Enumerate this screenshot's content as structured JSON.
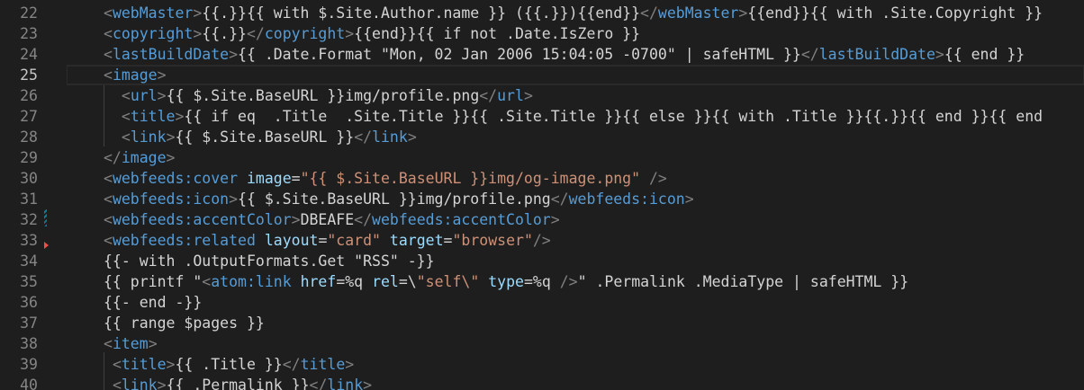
{
  "theme": {
    "background": "#1e1e1e",
    "line_number": "#858585",
    "line_number_active": "#c6c6c6",
    "tag_bracket": "#808080",
    "tag_name": "#569cd6",
    "attribute": "#9cdcfe",
    "string": "#ce9178",
    "text": "#d4d4d4",
    "gutter_modified": "#0c7d9d",
    "gutter_deleted": "#f14c4c"
  },
  "editor": {
    "active_line": 25,
    "lines": [
      {
        "num": "22",
        "tokens": [
          {
            "k": "tb",
            "t": "<"
          },
          {
            "k": "tn",
            "t": "webMaster"
          },
          {
            "k": "tb",
            "t": ">"
          },
          {
            "k": "tx",
            "t": "{{.}}{{ with $.Site.Author.name }} ({{.}}){{end}}"
          },
          {
            "k": "tb",
            "t": "</"
          },
          {
            "k": "tn",
            "t": "webMaster"
          },
          {
            "k": "tb",
            "t": ">"
          },
          {
            "k": "tx",
            "t": "{{end}}{{ with .Site.Copyright }}"
          }
        ]
      },
      {
        "num": "23",
        "tokens": [
          {
            "k": "tb",
            "t": "<"
          },
          {
            "k": "tn",
            "t": "copyright"
          },
          {
            "k": "tb",
            "t": ">"
          },
          {
            "k": "tx",
            "t": "{{.}}"
          },
          {
            "k": "tb",
            "t": "</"
          },
          {
            "k": "tn",
            "t": "copyright"
          },
          {
            "k": "tb",
            "t": ">"
          },
          {
            "k": "tx",
            "t": "{{end}}{{ if not .Date.IsZero }}"
          }
        ]
      },
      {
        "num": "24",
        "tokens": [
          {
            "k": "tb",
            "t": "<"
          },
          {
            "k": "tn",
            "t": "lastBuildDate"
          },
          {
            "k": "tb",
            "t": ">"
          },
          {
            "k": "tx",
            "t": "{{ .Date.Format \"Mon, 02 Jan 2006 15:04:05 -0700\" | safeHTML }}"
          },
          {
            "k": "tb",
            "t": "</"
          },
          {
            "k": "tn",
            "t": "lastBuildDate"
          },
          {
            "k": "tb",
            "t": ">"
          },
          {
            "k": "tx",
            "t": "{{ end }}"
          }
        ]
      },
      {
        "num": "25",
        "tokens": [
          {
            "k": "tb",
            "t": "<"
          },
          {
            "k": "tn",
            "t": "image"
          },
          {
            "k": "tb",
            "t": ">"
          }
        ]
      },
      {
        "num": "26",
        "tokens": [
          {
            "k": "tx",
            "t": "  "
          },
          {
            "k": "tb",
            "t": "<"
          },
          {
            "k": "tn",
            "t": "url"
          },
          {
            "k": "tb",
            "t": ">"
          },
          {
            "k": "tx",
            "t": "{{ $.Site.BaseURL }}img/profile.png"
          },
          {
            "k": "tb",
            "t": "</"
          },
          {
            "k": "tn",
            "t": "url"
          },
          {
            "k": "tb",
            "t": ">"
          }
        ]
      },
      {
        "num": "27",
        "tokens": [
          {
            "k": "tx",
            "t": "  "
          },
          {
            "k": "tb",
            "t": "<"
          },
          {
            "k": "tn",
            "t": "title"
          },
          {
            "k": "tb",
            "t": ">"
          },
          {
            "k": "tx",
            "t": "{{ if eq  .Title  .Site.Title }}{{ .Site.Title }}{{ else }}{{ with .Title }}{{.}}{{ end }}{{ end"
          }
        ]
      },
      {
        "num": "28",
        "tokens": [
          {
            "k": "tx",
            "t": "  "
          },
          {
            "k": "tb",
            "t": "<"
          },
          {
            "k": "tn",
            "t": "link"
          },
          {
            "k": "tb",
            "t": ">"
          },
          {
            "k": "tx",
            "t": "{{ $.Site.BaseURL }}"
          },
          {
            "k": "tb",
            "t": "</"
          },
          {
            "k": "tn",
            "t": "link"
          },
          {
            "k": "tb",
            "t": ">"
          }
        ]
      },
      {
        "num": "29",
        "tokens": [
          {
            "k": "tb",
            "t": "</"
          },
          {
            "k": "tn",
            "t": "image"
          },
          {
            "k": "tb",
            "t": ">"
          }
        ]
      },
      {
        "num": "30",
        "tokens": [
          {
            "k": "tb",
            "t": "<"
          },
          {
            "k": "tn",
            "t": "webfeeds:cover"
          },
          {
            "k": "tx",
            "t": " "
          },
          {
            "k": "at",
            "t": "image"
          },
          {
            "k": "tx",
            "t": "="
          },
          {
            "k": "st",
            "t": "\"{{ $.Site.BaseURL }}img/og-image.png\""
          },
          {
            "k": "tx",
            "t": " "
          },
          {
            "k": "tb",
            "t": "/>"
          }
        ]
      },
      {
        "num": "31",
        "tokens": [
          {
            "k": "tb",
            "t": "<"
          },
          {
            "k": "tn",
            "t": "webfeeds:icon"
          },
          {
            "k": "tb",
            "t": ">"
          },
          {
            "k": "tx",
            "t": "{{ $.Site.BaseURL }}img/profile.png"
          },
          {
            "k": "tb",
            "t": "</"
          },
          {
            "k": "tn",
            "t": "webfeeds:icon"
          },
          {
            "k": "tb",
            "t": ">"
          }
        ]
      },
      {
        "num": "32",
        "tokens": [
          {
            "k": "tb",
            "t": "<"
          },
          {
            "k": "tn",
            "t": "webfeeds:accentColor"
          },
          {
            "k": "tb",
            "t": ">"
          },
          {
            "k": "tx",
            "t": "DBEAFE"
          },
          {
            "k": "tb",
            "t": "</"
          },
          {
            "k": "tn",
            "t": "webfeeds:accentColor"
          },
          {
            "k": "tb",
            "t": ">"
          }
        ]
      },
      {
        "num": "33",
        "tokens": [
          {
            "k": "tb",
            "t": "<"
          },
          {
            "k": "tn",
            "t": "webfeeds:related"
          },
          {
            "k": "tx",
            "t": " "
          },
          {
            "k": "at",
            "t": "layout"
          },
          {
            "k": "tx",
            "t": "="
          },
          {
            "k": "st",
            "t": "\"card\""
          },
          {
            "k": "tx",
            "t": " "
          },
          {
            "k": "at",
            "t": "target"
          },
          {
            "k": "tx",
            "t": "="
          },
          {
            "k": "st",
            "t": "\"browser\""
          },
          {
            "k": "tb",
            "t": "/>"
          }
        ]
      },
      {
        "num": "34",
        "tokens": [
          {
            "k": "tx",
            "t": "{{- with .OutputFormats.Get \"RSS\" -}}"
          }
        ]
      },
      {
        "num": "35",
        "tokens": [
          {
            "k": "tx",
            "t": "{{ printf \""
          },
          {
            "k": "tb",
            "t": "<"
          },
          {
            "k": "tn",
            "t": "atom:link"
          },
          {
            "k": "tx",
            "t": " "
          },
          {
            "k": "at",
            "t": "href"
          },
          {
            "k": "tx",
            "t": "=%q "
          },
          {
            "k": "at",
            "t": "rel"
          },
          {
            "k": "tx",
            "t": "=\\"
          },
          {
            "k": "st",
            "t": "\"self\\\""
          },
          {
            "k": "tx",
            "t": " "
          },
          {
            "k": "at",
            "t": "type"
          },
          {
            "k": "tx",
            "t": "=%q "
          },
          {
            "k": "tb",
            "t": "/>"
          },
          {
            "k": "tx",
            "t": "\" .Permalink .MediaType | safeHTML }}"
          }
        ]
      },
      {
        "num": "36",
        "tokens": [
          {
            "k": "tx",
            "t": "{{- end -}}"
          }
        ]
      },
      {
        "num": "37",
        "tokens": [
          {
            "k": "tx",
            "t": "{{ range $pages }}"
          }
        ]
      },
      {
        "num": "38",
        "tokens": [
          {
            "k": "tb",
            "t": "<"
          },
          {
            "k": "tn",
            "t": "item"
          },
          {
            "k": "tb",
            "t": ">"
          }
        ]
      },
      {
        "num": "39",
        "tokens": [
          {
            "k": "tx",
            "t": " "
          },
          {
            "k": "tb",
            "t": "<"
          },
          {
            "k": "tn",
            "t": "title"
          },
          {
            "k": "tb",
            "t": ">"
          },
          {
            "k": "tx",
            "t": "{{ .Title }}"
          },
          {
            "k": "tb",
            "t": "</"
          },
          {
            "k": "tn",
            "t": "title"
          },
          {
            "k": "tb",
            "t": ">"
          }
        ]
      },
      {
        "num": "40",
        "tokens": [
          {
            "k": "tx",
            "t": " "
          },
          {
            "k": "tb",
            "t": "<"
          },
          {
            "k": "tn",
            "t": "link"
          },
          {
            "k": "tb",
            "t": ">"
          },
          {
            "k": "tx",
            "t": "{{ .Permalink }}"
          },
          {
            "k": "tb",
            "t": "</"
          },
          {
            "k": "tn",
            "t": "link"
          },
          {
            "k": "tb",
            "t": ">"
          }
        ]
      }
    ]
  }
}
